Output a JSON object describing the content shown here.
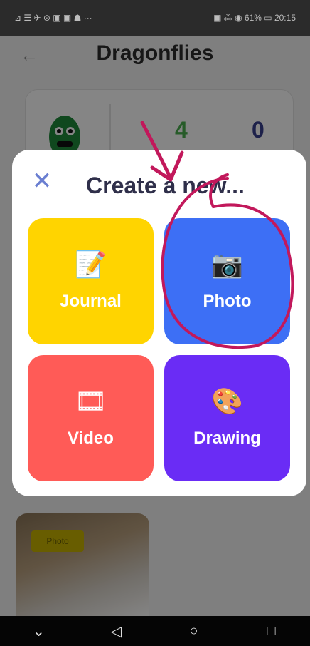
{
  "status_bar": {
    "left": "⊿ ☰ ✈ ⊙ ▣ ▣ ☗ ···",
    "right": "▣ ⁂ ◉ 61% ▭ 20:15"
  },
  "header": {
    "title": "Dragonflies",
    "back_icon": "back-arrow-icon"
  },
  "profile_card": {
    "count_a": "4",
    "count_b": "0"
  },
  "post_tile": {
    "badge": "Photo"
  },
  "modal": {
    "title": "Create a new...",
    "close_glyph": "✕",
    "options": [
      {
        "label": "Journal",
        "emoji": "📝",
        "color": "#ffd400"
      },
      {
        "label": "Photo",
        "emoji": "📷",
        "color": "#3d6ff5"
      },
      {
        "label": "Video",
        "emoji": "🎞",
        "color": "#ff5b57"
      },
      {
        "label": "Drawing",
        "emoji": "🎨",
        "color": "#6a2cf5"
      }
    ]
  },
  "nav_bar": {
    "back": "◁",
    "home": "○",
    "recents": "□",
    "down": "⌄"
  },
  "annotation": {
    "color": "#c2185b"
  }
}
